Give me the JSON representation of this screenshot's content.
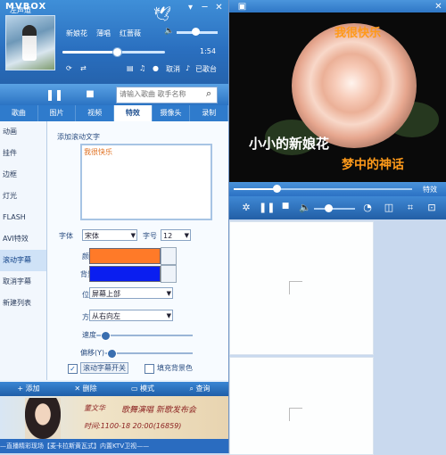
{
  "app": {
    "title": "MVBOX",
    "window_buttons": [
      "▾",
      "─",
      "✕"
    ]
  },
  "now_playing": {
    "songs": [
      "新娘花",
      "薄唱",
      "红蔷薇"
    ],
    "elapsed": "1:54",
    "progress": 0.52,
    "volume": 0.45,
    "links": {
      "cancel": "取消",
      "karaoke": "已歌台"
    }
  },
  "controls": {
    "sound_label": "左声道",
    "pause_icon": "pause-icon",
    "stop_icon": "stop-icon"
  },
  "search": {
    "placeholder": "请输入歌曲 歌手名称"
  },
  "tabs": [
    "歌曲",
    "图片",
    "视频",
    "特效",
    "摄像头",
    "录制"
  ],
  "active_tab": 3,
  "sidebar": {
    "items": [
      "动画",
      "挂件",
      "边框",
      "灯光",
      "FLASH",
      "AVI特效",
      "滚动字幕",
      "取消字幕",
      "新建列表"
    ],
    "active": 6
  },
  "panel": {
    "add_text_label": "添加滚动文字",
    "text_value": "我很快乐",
    "font_label": "字体",
    "font_value": "宋体",
    "size_label": "字号",
    "size_value": "12",
    "color_label": "颜色",
    "color": "#ff7a28",
    "bg_color_label": "背景色",
    "bg_color": "#0a1ef0",
    "position_label": "位置",
    "position_value": "屏幕上部",
    "direction_label": "方向",
    "direction_value": "从右向左",
    "speed_label": "速度",
    "speed": 0.08,
    "offset_label": "偏移(Y)",
    "offset": 0.06,
    "toggle_label": "滚动字幕开关",
    "toggle_checked": true,
    "fill_bg_label": "填充背景色",
    "fill_bg_checked": false
  },
  "bottom_bar": [
    "+ 添加",
    "✕ 删除",
    "▭ 模式",
    "⌕ 查询"
  ],
  "ad": {
    "line1": "董文华",
    "line2": "歌舞演唱 新歌发布会",
    "line3": "时间:1100-18 20:00(16859)"
  },
  "ticker": "—直播精彩现场【麦卡拉斯黄瓦式】内置KTV卫视——",
  "video": {
    "lyric_top": "我很快乐",
    "lyric_mid": "小小的新娘花",
    "lyric_bot": "梦中的神话",
    "lyric_top_color": "#ff9a1a",
    "lyric_mid_color": "#ffffff",
    "lyric_bot_color": "#ff9a1a",
    "seek": 0.24,
    "volume": 0.35,
    "effects_link": "特效"
  }
}
